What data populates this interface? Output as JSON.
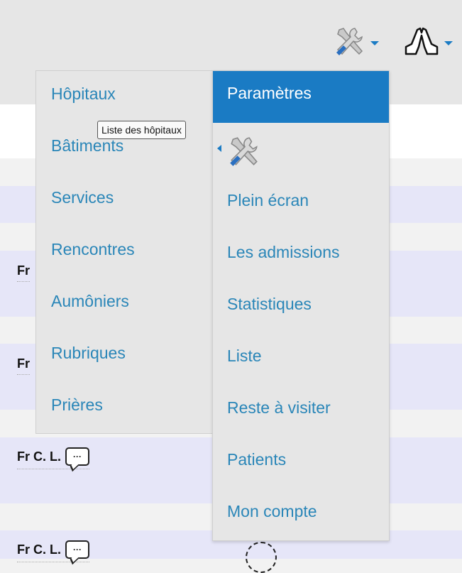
{
  "header": {
    "icons": [
      "tools-icon",
      "praying-hands-icon"
    ]
  },
  "left_menu": {
    "items": [
      "Hôpitaux",
      "Bâtiments",
      "Services",
      "Rencontres",
      "Aumôniers",
      "Rubriques",
      "Prières"
    ]
  },
  "tooltip": {
    "text": "Liste des hôpitaux"
  },
  "right_menu": {
    "header": "Paramètres",
    "items": [
      "Plein écran",
      "Les admissions",
      "Statistiques",
      "Liste",
      "Reste à visiter",
      "Patients",
      "Mon compte"
    ]
  },
  "background_rows": [
    {
      "name": "Fr"
    },
    {
      "name": "Fr"
    },
    {
      "name": "Fr C. L."
    },
    {
      "name": "Fr C. L."
    }
  ],
  "colors": {
    "accent": "#1a7bc4",
    "link": "#2a86b8",
    "row_alt": "#e6e6f8",
    "menu_bg": "#e6e6e6"
  }
}
